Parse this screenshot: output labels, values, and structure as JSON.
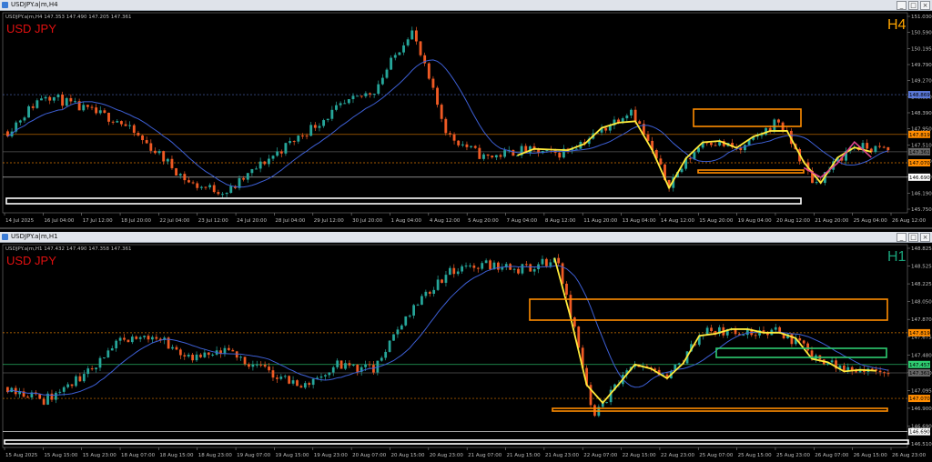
{
  "windows": [
    {
      "window_title": "USDJPY.a|m,H4",
      "info_line": "USDJPY.a|m,H4  147.353 147.490 147.205 147.361",
      "symbol_label": "USD JPY",
      "timeframe_label": "H4",
      "buttons": [
        "_",
        "□",
        "×"
      ],
      "colors": {
        "bull": "#26a69a",
        "bear": "#ef5a24",
        "ma": "#3d5fd4",
        "zigzag": "#ffeb3b",
        "zigzag2": "#e04890",
        "box": "#ff8c00",
        "symbol": "#e01010",
        "tf": "#ffa500"
      },
      "y_ticks": [
        "151.030",
        "150.590",
        "150.195",
        "149.790",
        "149.270",
        "148.850",
        "148.390",
        "147.950",
        "147.510",
        "147.070",
        "146.630",
        "146.190",
        "145.750"
      ],
      "x_ticks": [
        "14 Jul 2025",
        "16 Jul 04:00",
        "17 Jul 12:00",
        "18 Jul 20:00",
        "22 Jul 04:00",
        "23 Jul 12:00",
        "24 Jul 20:00",
        "28 Jul 04:00",
        "29 Jul 12:00",
        "30 Jul 20:00",
        "1 Aug 04:00",
        "4 Aug 12:00",
        "5 Aug 20:00",
        "7 Aug 04:00",
        "8 Aug 12:00",
        "11 Aug 20:00",
        "13 Aug 04:00",
        "14 Aug 12:00",
        "15 Aug 20:00",
        "19 Aug 04:00",
        "20 Aug 12:00",
        "21 Aug 20:00",
        "25 Aug 04:00",
        "26 Aug 12:00"
      ],
      "price_tags": [
        {
          "label": "148.869",
          "color": "#5a78d8"
        },
        {
          "label": "147.819",
          "color": "#ff8c00"
        },
        {
          "label": "147.361",
          "color": "#666666"
        },
        {
          "label": "147.070",
          "color": "#ff8c00"
        },
        {
          "label": "146.690",
          "color": "#ffffff"
        }
      ]
    },
    {
      "window_title": "USDJPY.a|m,H1",
      "info_line": "USDJPY.a|m,H1  147.432 147.490 147.358 147.361",
      "symbol_label": "USD JPY",
      "timeframe_label": "H1",
      "buttons": [
        "_",
        "□",
        "×"
      ],
      "colors": {
        "bull": "#26a69a",
        "bear": "#ef5a24",
        "ma": "#3d5fd4",
        "zigzag": "#ffeb3b",
        "box": "#ff8c00",
        "box2": "#2ecc71",
        "symbol": "#e01010",
        "tf": "#1aa37a"
      },
      "y_ticks": [
        "148.825",
        "148.525",
        "148.225",
        "148.050",
        "147.870",
        "147.675",
        "147.480",
        "147.290",
        "147.095",
        "146.900",
        "146.690",
        "146.510"
      ],
      "x_ticks": [
        "15 Aug 2025",
        "15 Aug 15:00",
        "15 Aug 23:00",
        "18 Aug 07:00",
        "18 Aug 15:00",
        "18 Aug 23:00",
        "19 Aug 07:00",
        "19 Aug 15:00",
        "19 Aug 23:00",
        "20 Aug 07:00",
        "20 Aug 15:00",
        "20 Aug 23:00",
        "21 Aug 07:00",
        "21 Aug 15:00",
        "21 Aug 23:00",
        "22 Aug 07:00",
        "22 Aug 15:00",
        "22 Aug 23:00",
        "25 Aug 07:00",
        "25 Aug 15:00",
        "25 Aug 23:00",
        "26 Aug 07:00",
        "26 Aug 15:00",
        "26 Aug 23:00"
      ],
      "price_tags": [
        {
          "label": "147.819",
          "color": "#ff8c00"
        },
        {
          "label": "147.457",
          "color": "#2ecc71"
        },
        {
          "label": "147.361",
          "color": "#666666"
        },
        {
          "label": "147.070",
          "color": "#ff8c00"
        },
        {
          "label": "146.690",
          "color": "#ffffff"
        }
      ]
    }
  ],
  "chart_data": [
    {
      "type": "candlestick",
      "title": "USD JPY H4",
      "ylim": [
        145.75,
        151.03
      ],
      "x": [
        "14 Jul 2025",
        "16 Jul 04:00",
        "17 Jul 12:00",
        "18 Jul 20:00",
        "22 Jul 04:00",
        "23 Jul 12:00",
        "24 Jul 20:00",
        "28 Jul 04:00",
        "29 Jul 12:00",
        "30 Jul 20:00",
        "1 Aug 04:00",
        "4 Aug 12:00",
        "5 Aug 20:00",
        "7 Aug 04:00",
        "8 Aug 12:00",
        "11 Aug 20:00",
        "13 Aug 04:00",
        "14 Aug 12:00",
        "15 Aug 20:00",
        "19 Aug 04:00",
        "20 Aug 12:00",
        "21 Aug 20:00",
        "25 Aug 04:00",
        "26 Aug 12:00"
      ],
      "close_path": [
        147.9,
        148.9,
        148.5,
        148.2,
        147.4,
        146.5,
        146.3,
        147.1,
        147.8,
        148.5,
        149.0,
        150.6,
        147.8,
        147.2,
        147.4,
        147.3,
        147.8,
        148.5,
        146.5,
        147.7,
        147.4,
        148.2,
        146.5,
        147.5,
        147.4
      ],
      "levels": [
        148.869,
        147.819,
        147.361,
        147.07,
        146.69
      ]
    },
    {
      "type": "candlestick",
      "title": "USD JPY H1",
      "ylim": [
        146.51,
        148.825
      ],
      "x": [
        "15 Aug 2025",
        "15 Aug 15:00",
        "15 Aug 23:00",
        "18 Aug 07:00",
        "18 Aug 15:00",
        "18 Aug 23:00",
        "19 Aug 07:00",
        "19 Aug 15:00",
        "19 Aug 23:00",
        "20 Aug 07:00",
        "20 Aug 15:00",
        "20 Aug 23:00",
        "21 Aug 07:00",
        "21 Aug 15:00",
        "21 Aug 23:00",
        "22 Aug 07:00",
        "22 Aug 15:00",
        "22 Aug 23:00",
        "25 Aug 07:00",
        "25 Aug 15:00",
        "25 Aug 23:00",
        "26 Aug 07:00",
        "26 Aug 15:00",
        "26 Aug 23:00"
      ],
      "close_path": [
        147.2,
        147.05,
        147.3,
        147.7,
        147.8,
        147.5,
        147.6,
        147.4,
        147.2,
        147.45,
        147.4,
        148.1,
        148.5,
        148.6,
        148.55,
        148.65,
        146.85,
        147.45,
        147.3,
        147.85,
        147.8,
        147.85,
        147.55,
        147.4,
        147.35
      ],
      "levels": [
        147.819,
        147.457,
        147.361,
        147.07,
        146.69
      ]
    }
  ]
}
